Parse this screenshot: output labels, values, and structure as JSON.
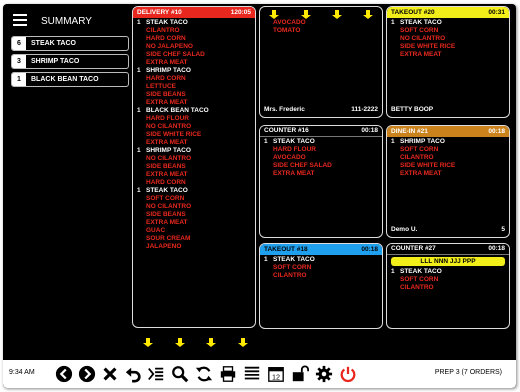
{
  "summary": {
    "title": "SUMMARY",
    "items": [
      {
        "count": "6",
        "label": "STEAK TACO"
      },
      {
        "count": "3",
        "label": "SHRIMP TACO"
      },
      {
        "count": "1",
        "label": "BLACK BEAN TACO"
      }
    ]
  },
  "tickets": {
    "delivery10": {
      "title": "DELIVERY #10",
      "time": "120:05",
      "lines": [
        {
          "qty": "1",
          "item": "STEAK TACO",
          "mods": [
            "CILANTRO",
            "HARD CORN",
            "NO JALAPENO",
            "SIDE CHEF SALAD",
            "EXTRA MEAT"
          ]
        },
        {
          "qty": "1",
          "item": "SHRIMP TACO",
          "mods": [
            "HARD CORN",
            "LETTUCE",
            "SIDE BEANS",
            "EXTRA MEAT"
          ]
        },
        {
          "qty": "1",
          "item": "BLACK BEAN TACO",
          "mods": [
            "HARD FLOUR",
            "NO CILANTRO",
            "SIDE WHITE RICE",
            "EXTRA MEAT"
          ]
        },
        {
          "qty": "1",
          "item": "SHRIMP TACO",
          "mods": [
            "NO CILANTRO",
            "SIDE BEANS",
            "EXTRA MEAT",
            "HARD CORN"
          ]
        },
        {
          "qty": "1",
          "item": "STEAK TACO",
          "mods": [
            "SOFT CORN",
            "NO CILANTRO",
            "SIDE BEANS",
            "EXTRA MEAT",
            "GUAC",
            "SOUR CREAM",
            "JALAPENO"
          ]
        }
      ]
    },
    "cont": {
      "mods": [
        "AVOCADO",
        "TOMATO"
      ],
      "footer_name": "Mrs. Frederic",
      "footer_phone": "111-2222"
    },
    "takeout20": {
      "title": "TAKEOUT #20",
      "time": "00:31",
      "lines": [
        {
          "qty": "1",
          "item": "STEAK TACO",
          "mods": [
            "SOFT CORN",
            "NO CILANTRO",
            "SIDE WHITE RICE",
            "EXTRA MEAT"
          ]
        }
      ],
      "footer_name": "BETTY BOOP"
    },
    "counter16": {
      "title": "COUNTER #16",
      "time": "00:18",
      "lines": [
        {
          "qty": "1",
          "item": "STEAK TACO",
          "mods": [
            "HARD FLOUR",
            "AVOCADO",
            "SIDE CHEF SALAD",
            "EXTRA MEAT"
          ]
        }
      ]
    },
    "dinein21": {
      "title": "DINE-IN #21",
      "time": "00:18",
      "lines": [
        {
          "qty": "1",
          "item": "SHRIMP TACO",
          "mods": [
            "SOFT CORN",
            "CILANTRO",
            "SIDE WHITE RICE",
            "EXTRA MEAT"
          ]
        }
      ],
      "footer_name": "Demo U.",
      "footer_num": "5"
    },
    "takeout18": {
      "title": "TAKEOUT #18",
      "time": "00:18",
      "lines": [
        {
          "qty": "1",
          "item": "STEAK TACO",
          "mods": [
            "SOFT CORN",
            "CILANTRO"
          ]
        }
      ]
    },
    "counter27": {
      "title": "COUNTER #27",
      "time": "00:18",
      "banner": "LLL NNN JJJ PPP",
      "lines": [
        {
          "qty": "1",
          "item": "STEAK TACO",
          "mods": [
            "SOFT CORN",
            "CILANTRO"
          ]
        }
      ]
    }
  },
  "toolbar": {
    "time": "9:34 AM",
    "status": "PREP 3 (7 ORDERS)",
    "calendar_day": "12",
    "icons": [
      "prev-icon",
      "next-icon",
      "close-icon",
      "undo-icon",
      "sum-icon",
      "search-icon",
      "refresh-icon",
      "print-icon",
      "list-icon",
      "calendar-icon",
      "unlock-icon",
      "gear-icon",
      "power-icon"
    ]
  },
  "colors": {
    "delivery": "#e8281e",
    "takeout_yellow": "#f2ee1a",
    "dinein": "#c9821c",
    "takeout_blue": "#1fa0ef",
    "modifier": "#e8281e",
    "arrow": "#ffe900"
  }
}
